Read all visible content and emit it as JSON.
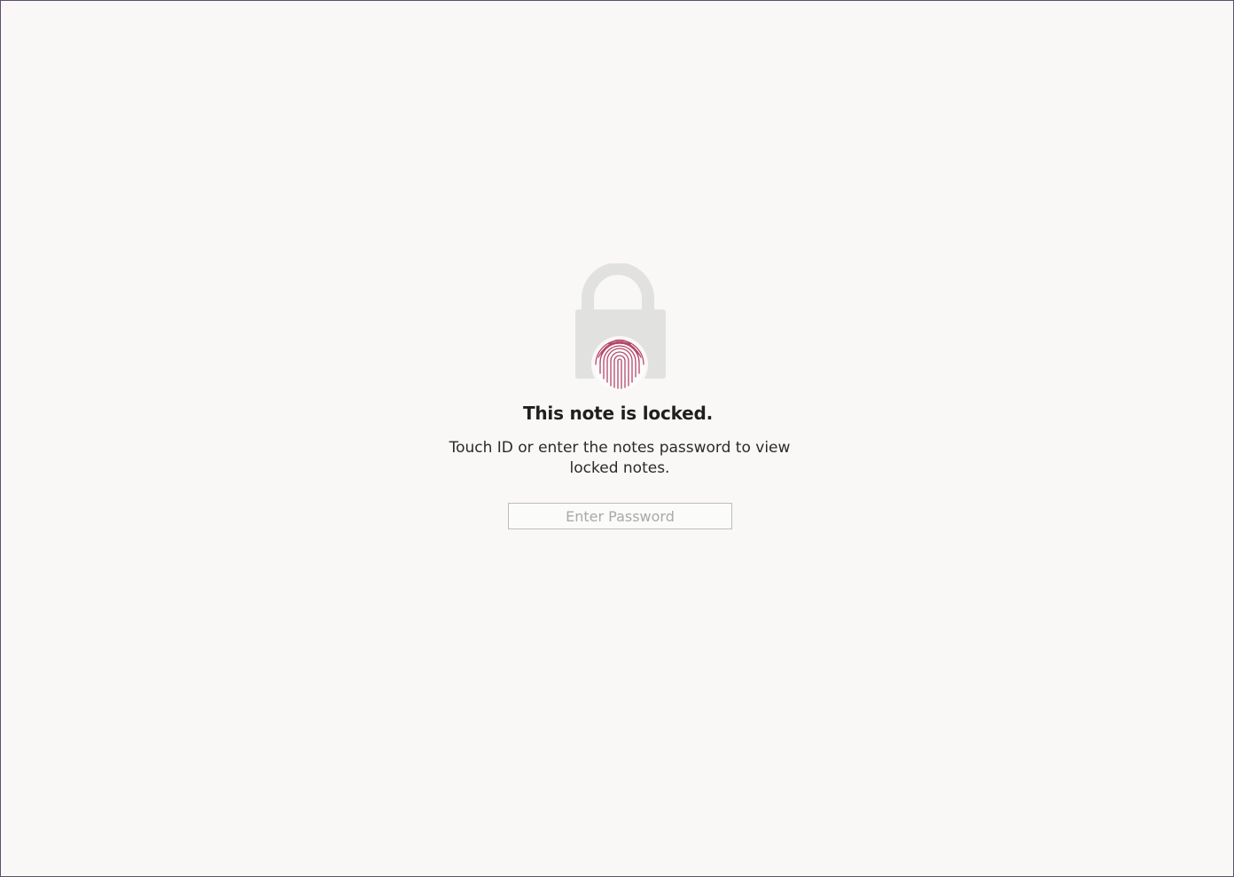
{
  "locked_note": {
    "title": "This note is locked.",
    "message": "Touch ID or enter the notes password to view locked notes.",
    "password_placeholder": "Enter Password",
    "password_value": ""
  },
  "icons": {
    "lock": "lock-icon",
    "fingerprint": "fingerprint-icon"
  },
  "colors": {
    "background": "#f9f8f6",
    "lock_gray": "#e1e1e0",
    "fingerprint_pink": "#b5476b",
    "border": "#5e4e73"
  }
}
